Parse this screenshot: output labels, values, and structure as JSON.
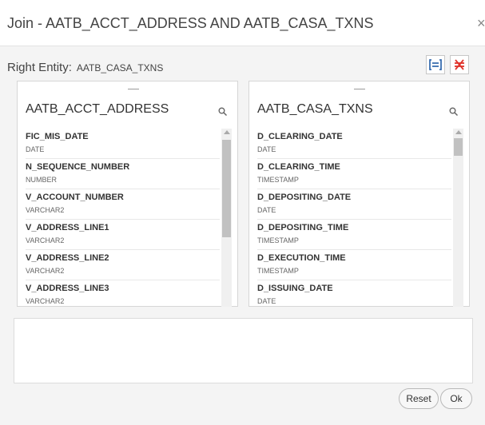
{
  "dialog": {
    "title": "Join - AATB_ACCT_ADDRESS AND AATB_CASA_TXNS",
    "close_glyph": "×"
  },
  "right_entity": {
    "label": "Right Entity:",
    "value": "AATB_CASA_TXNS"
  },
  "toolbar": {
    "join_icon": "join-icon",
    "remove_join_icon": "remove-join-icon",
    "accent_color": "#e0332b",
    "join_color": "#3a6fb0"
  },
  "left_panel": {
    "title": "AATB_ACCT_ADDRESS",
    "columns": [
      {
        "name": "FIC_MIS_DATE",
        "type": "DATE"
      },
      {
        "name": "N_SEQUENCE_NUMBER",
        "type": "NUMBER"
      },
      {
        "name": "V_ACCOUNT_NUMBER",
        "type": "VARCHAR2"
      },
      {
        "name": "V_ADDRESS_LINE1",
        "type": "VARCHAR2"
      },
      {
        "name": "V_ADDRESS_LINE2",
        "type": "VARCHAR2"
      },
      {
        "name": "V_ADDRESS_LINE3",
        "type": "VARCHAR2"
      }
    ]
  },
  "right_panel": {
    "title": "AATB_CASA_TXNS",
    "columns": [
      {
        "name": "D_CLEARING_DATE",
        "type": "DATE"
      },
      {
        "name": "D_CLEARING_TIME",
        "type": "TIMESTAMP"
      },
      {
        "name": "D_DEPOSITING_DATE",
        "type": "DATE"
      },
      {
        "name": "D_DEPOSITING_TIME",
        "type": "TIMESTAMP"
      },
      {
        "name": "D_EXECUTION_TIME",
        "type": "TIMESTAMP"
      },
      {
        "name": "D_ISSUING_DATE",
        "type": "DATE"
      }
    ]
  },
  "buttons": {
    "reset": "Reset",
    "ok": "Ok"
  }
}
